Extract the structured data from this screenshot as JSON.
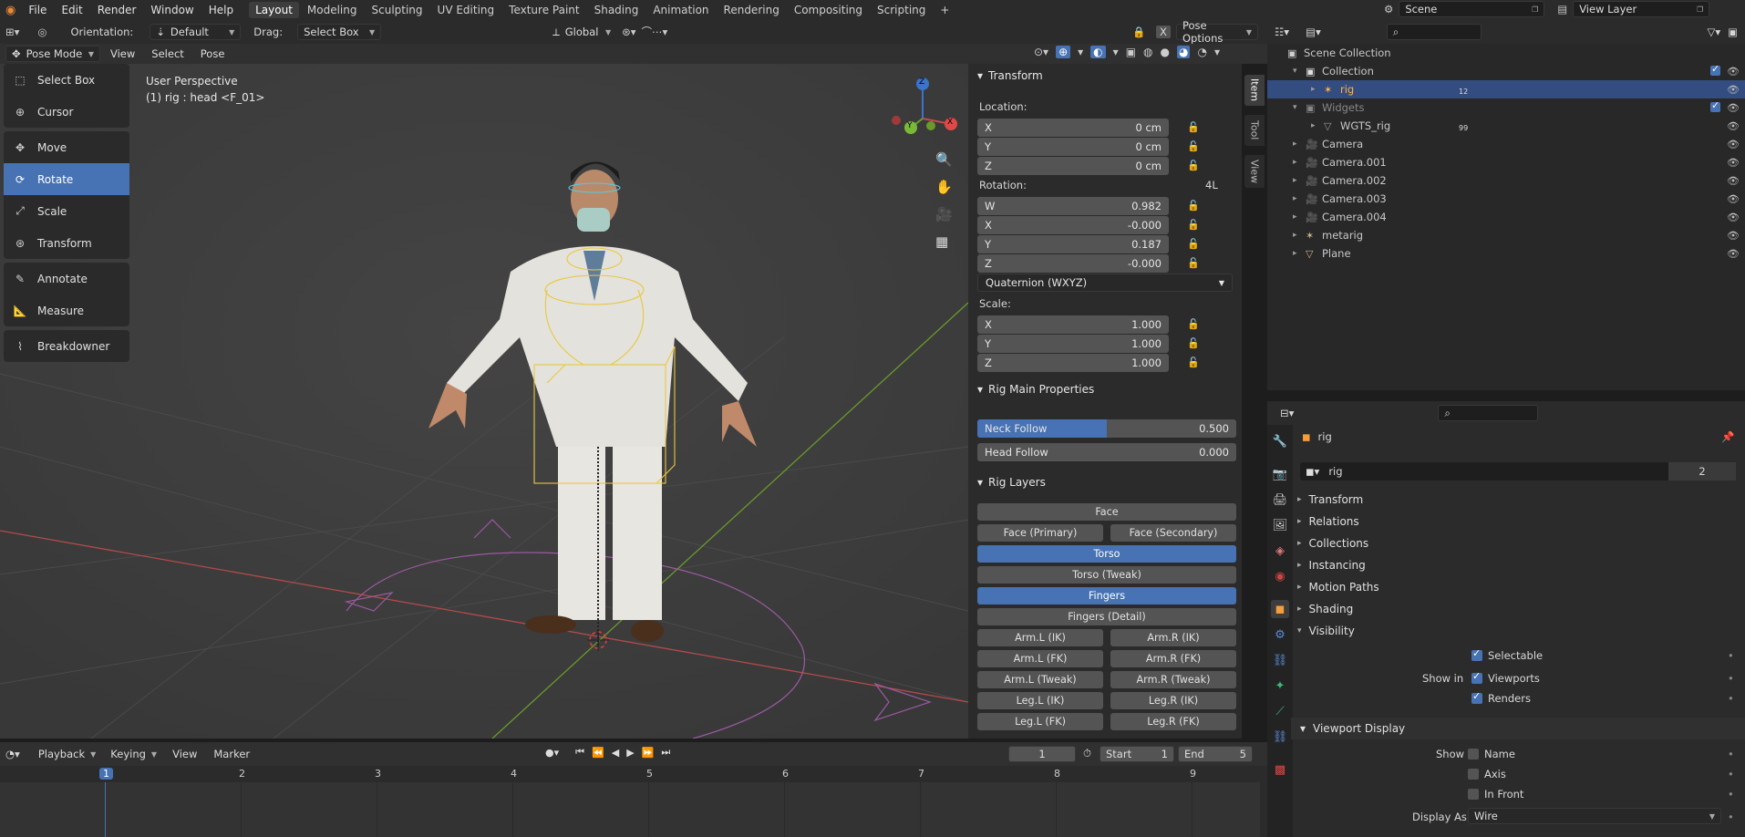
{
  "menu": {
    "items": [
      "File",
      "Edit",
      "Render",
      "Window",
      "Help"
    ]
  },
  "workspaces": [
    "Layout",
    "Modeling",
    "Sculpting",
    "UV Editing",
    "Texture Paint",
    "Shading",
    "Animation",
    "Rendering",
    "Compositing",
    "Scripting"
  ],
  "workspace_add": "+",
  "scene": {
    "label": "Scene",
    "view_layer": "View Layer"
  },
  "header": {
    "orientation_label": "Orientation:",
    "orientation_value": "Default",
    "drag_label": "Drag:",
    "drag_value": "Select Box",
    "transform_orient": "Global",
    "pose_options": "Pose Options",
    "x_btn": "X"
  },
  "view_header": {
    "mode": "Pose Mode",
    "menus": [
      "View",
      "Select",
      "Pose"
    ]
  },
  "viewport": {
    "perspective": "User Perspective",
    "info": "(1) rig : head <F_01>"
  },
  "tools": [
    {
      "label": "Select Box",
      "icon": "select-box-icon"
    },
    {
      "label": "Cursor",
      "icon": "cursor-icon"
    },
    {
      "label": "Move",
      "icon": "move-icon"
    },
    {
      "label": "Rotate",
      "icon": "rotate-icon",
      "active": true
    },
    {
      "label": "Scale",
      "icon": "scale-icon"
    },
    {
      "label": "Transform",
      "icon": "transform-icon"
    },
    {
      "label": "Annotate",
      "icon": "annotate-icon"
    },
    {
      "label": "Measure",
      "icon": "measure-icon"
    },
    {
      "label": "Breakdowner",
      "icon": "breakdowner-icon"
    }
  ],
  "gizmo": {
    "z": "Z",
    "y": "Y",
    "x": "X"
  },
  "npanel": {
    "tabs": [
      "Item",
      "Tool",
      "View"
    ],
    "transform": {
      "title": "Transform",
      "location_label": "Location:",
      "location": [
        {
          "axis": "X",
          "value": "0 cm"
        },
        {
          "axis": "Y",
          "value": "0 cm"
        },
        {
          "axis": "Z",
          "value": "0 cm"
        }
      ],
      "rotation_label": "Rotation:",
      "rotation_mode_short": "4L",
      "rotation": [
        {
          "axis": "W",
          "value": "0.982"
        },
        {
          "axis": "X",
          "value": "-0.000"
        },
        {
          "axis": "Y",
          "value": "0.187"
        },
        {
          "axis": "Z",
          "value": "-0.000"
        }
      ],
      "rotation_mode": "Quaternion (WXYZ)",
      "scale_label": "Scale:",
      "scale": [
        {
          "axis": "X",
          "value": "1.000"
        },
        {
          "axis": "Y",
          "value": "1.000"
        },
        {
          "axis": "Z",
          "value": "1.000"
        }
      ]
    },
    "rig_main": {
      "title": "Rig Main Properties",
      "neck_label": "Neck Follow",
      "neck_value": "0.500",
      "neck_fraction": 0.5,
      "head_label": "Head Follow",
      "head_value": "0.000"
    },
    "rig_layers": {
      "title": "Rig Layers",
      "buttons": [
        {
          "label": "Face",
          "on": false,
          "col": "full"
        },
        {
          "label": "Face (Primary)",
          "on": false,
          "col": "l"
        },
        {
          "label": "Face (Secondary)",
          "on": false,
          "col": "r"
        },
        {
          "label": "Torso",
          "on": true,
          "col": "full"
        },
        {
          "label": "Torso (Tweak)",
          "on": false,
          "col": "full"
        },
        {
          "label": "Fingers",
          "on": true,
          "col": "full"
        },
        {
          "label": "Fingers (Detail)",
          "on": false,
          "col": "full"
        },
        {
          "label": "Arm.L (IK)",
          "on": false,
          "col": "l"
        },
        {
          "label": "Arm.R (IK)",
          "on": false,
          "col": "r"
        },
        {
          "label": "Arm.L (FK)",
          "on": false,
          "col": "l"
        },
        {
          "label": "Arm.R (FK)",
          "on": false,
          "col": "r"
        },
        {
          "label": "Arm.L (Tweak)",
          "on": false,
          "col": "l"
        },
        {
          "label": "Arm.R (Tweak)",
          "on": false,
          "col": "r"
        },
        {
          "label": "Leg.L (IK)",
          "on": false,
          "col": "l"
        },
        {
          "label": "Leg.R (IK)",
          "on": false,
          "col": "r"
        },
        {
          "label": "Leg.L (FK)",
          "on": false,
          "col": "l"
        },
        {
          "label": "Leg.R (FK)",
          "on": false,
          "col": "r"
        }
      ]
    }
  },
  "outliner": {
    "rows": [
      {
        "label": "Scene Collection",
        "indent": 0,
        "icon": "scene-collection-icon",
        "color": "#d0d0d0"
      },
      {
        "label": "Collection",
        "indent": 1,
        "icon": "collection-icon",
        "color": "#e0e0e0",
        "check": true
      },
      {
        "label": "rig",
        "indent": 2,
        "icon": "armature-icon",
        "color": "#ffb14a",
        "selected": true,
        "badge": "12"
      },
      {
        "label": "Widgets",
        "indent": 1,
        "icon": "collection-icon",
        "color": "#888",
        "check": true
      },
      {
        "label": "WGTS_rig",
        "indent": 2,
        "icon": "mesh-icon",
        "color": "#999",
        "badge": "99"
      },
      {
        "label": "Camera",
        "indent": 1,
        "icon": "camera-icon",
        "color": "#c8b48a"
      },
      {
        "label": "Camera.001",
        "indent": 1,
        "icon": "camera-icon",
        "color": "#c8b48a"
      },
      {
        "label": "Camera.002",
        "indent": 1,
        "icon": "camera-icon",
        "color": "#c8b48a"
      },
      {
        "label": "Camera.003",
        "indent": 1,
        "icon": "camera-icon",
        "color": "#c8b48a"
      },
      {
        "label": "Camera.004",
        "indent": 1,
        "icon": "camera-icon",
        "color": "#c8b48a"
      },
      {
        "label": "metarig",
        "indent": 1,
        "icon": "armature-icon",
        "color": "#c8b48a"
      },
      {
        "label": "Plane",
        "indent": 1,
        "icon": "mesh-icon",
        "color": "#c8b48a"
      }
    ]
  },
  "properties": {
    "object_name": "rig",
    "name_field": "rig",
    "users": "2",
    "sections": [
      "Transform",
      "Relations",
      "Collections",
      "Instancing",
      "Motion Paths",
      "Shading",
      "Visibility"
    ],
    "visibility": {
      "selectable": "Selectable",
      "show_in": "Show in",
      "viewports": "Viewports",
      "renders": "Renders"
    },
    "viewport_display": {
      "title": "Viewport Display",
      "show": "Show",
      "name": "Name",
      "axis": "Axis",
      "in_front": "In Front",
      "display_as": "Display As",
      "display_value": "Wire"
    }
  },
  "timeline": {
    "menus": [
      "Playback",
      "Keying",
      "View",
      "Marker"
    ],
    "current": "1",
    "start_label": "Start",
    "start": "1",
    "end_label": "End",
    "end": "5",
    "frames": [
      "1",
      "2",
      "3",
      "4",
      "5",
      "6",
      "7",
      "8",
      "9"
    ]
  }
}
